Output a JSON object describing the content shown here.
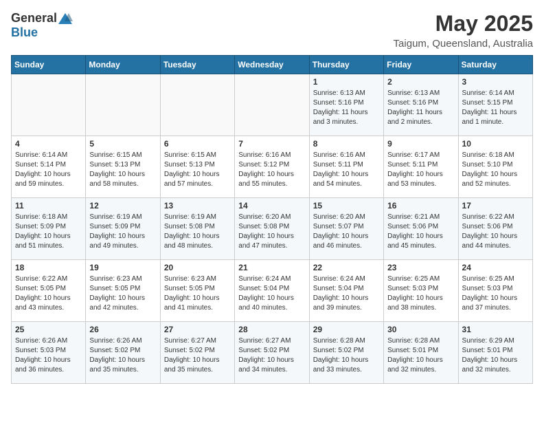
{
  "header": {
    "logo_general": "General",
    "logo_blue": "Blue",
    "month": "May 2025",
    "location": "Taigum, Queensland, Australia"
  },
  "days_of_week": [
    "Sunday",
    "Monday",
    "Tuesday",
    "Wednesday",
    "Thursday",
    "Friday",
    "Saturday"
  ],
  "weeks": [
    [
      {
        "day": "",
        "info": ""
      },
      {
        "day": "",
        "info": ""
      },
      {
        "day": "",
        "info": ""
      },
      {
        "day": "",
        "info": ""
      },
      {
        "day": "1",
        "info": "Sunrise: 6:13 AM\nSunset: 5:16 PM\nDaylight: 11 hours\nand 3 minutes."
      },
      {
        "day": "2",
        "info": "Sunrise: 6:13 AM\nSunset: 5:16 PM\nDaylight: 11 hours\nand 2 minutes."
      },
      {
        "day": "3",
        "info": "Sunrise: 6:14 AM\nSunset: 5:15 PM\nDaylight: 11 hours\nand 1 minute."
      }
    ],
    [
      {
        "day": "4",
        "info": "Sunrise: 6:14 AM\nSunset: 5:14 PM\nDaylight: 10 hours\nand 59 minutes."
      },
      {
        "day": "5",
        "info": "Sunrise: 6:15 AM\nSunset: 5:13 PM\nDaylight: 10 hours\nand 58 minutes."
      },
      {
        "day": "6",
        "info": "Sunrise: 6:15 AM\nSunset: 5:13 PM\nDaylight: 10 hours\nand 57 minutes."
      },
      {
        "day": "7",
        "info": "Sunrise: 6:16 AM\nSunset: 5:12 PM\nDaylight: 10 hours\nand 55 minutes."
      },
      {
        "day": "8",
        "info": "Sunrise: 6:16 AM\nSunset: 5:11 PM\nDaylight: 10 hours\nand 54 minutes."
      },
      {
        "day": "9",
        "info": "Sunrise: 6:17 AM\nSunset: 5:11 PM\nDaylight: 10 hours\nand 53 minutes."
      },
      {
        "day": "10",
        "info": "Sunrise: 6:18 AM\nSunset: 5:10 PM\nDaylight: 10 hours\nand 52 minutes."
      }
    ],
    [
      {
        "day": "11",
        "info": "Sunrise: 6:18 AM\nSunset: 5:09 PM\nDaylight: 10 hours\nand 51 minutes."
      },
      {
        "day": "12",
        "info": "Sunrise: 6:19 AM\nSunset: 5:09 PM\nDaylight: 10 hours\nand 49 minutes."
      },
      {
        "day": "13",
        "info": "Sunrise: 6:19 AM\nSunset: 5:08 PM\nDaylight: 10 hours\nand 48 minutes."
      },
      {
        "day": "14",
        "info": "Sunrise: 6:20 AM\nSunset: 5:08 PM\nDaylight: 10 hours\nand 47 minutes."
      },
      {
        "day": "15",
        "info": "Sunrise: 6:20 AM\nSunset: 5:07 PM\nDaylight: 10 hours\nand 46 minutes."
      },
      {
        "day": "16",
        "info": "Sunrise: 6:21 AM\nSunset: 5:06 PM\nDaylight: 10 hours\nand 45 minutes."
      },
      {
        "day": "17",
        "info": "Sunrise: 6:22 AM\nSunset: 5:06 PM\nDaylight: 10 hours\nand 44 minutes."
      }
    ],
    [
      {
        "day": "18",
        "info": "Sunrise: 6:22 AM\nSunset: 5:05 PM\nDaylight: 10 hours\nand 43 minutes."
      },
      {
        "day": "19",
        "info": "Sunrise: 6:23 AM\nSunset: 5:05 PM\nDaylight: 10 hours\nand 42 minutes."
      },
      {
        "day": "20",
        "info": "Sunrise: 6:23 AM\nSunset: 5:05 PM\nDaylight: 10 hours\nand 41 minutes."
      },
      {
        "day": "21",
        "info": "Sunrise: 6:24 AM\nSunset: 5:04 PM\nDaylight: 10 hours\nand 40 minutes."
      },
      {
        "day": "22",
        "info": "Sunrise: 6:24 AM\nSunset: 5:04 PM\nDaylight: 10 hours\nand 39 minutes."
      },
      {
        "day": "23",
        "info": "Sunrise: 6:25 AM\nSunset: 5:03 PM\nDaylight: 10 hours\nand 38 minutes."
      },
      {
        "day": "24",
        "info": "Sunrise: 6:25 AM\nSunset: 5:03 PM\nDaylight: 10 hours\nand 37 minutes."
      }
    ],
    [
      {
        "day": "25",
        "info": "Sunrise: 6:26 AM\nSunset: 5:03 PM\nDaylight: 10 hours\nand 36 minutes."
      },
      {
        "day": "26",
        "info": "Sunrise: 6:26 AM\nSunset: 5:02 PM\nDaylight: 10 hours\nand 35 minutes."
      },
      {
        "day": "27",
        "info": "Sunrise: 6:27 AM\nSunset: 5:02 PM\nDaylight: 10 hours\nand 35 minutes."
      },
      {
        "day": "28",
        "info": "Sunrise: 6:27 AM\nSunset: 5:02 PM\nDaylight: 10 hours\nand 34 minutes."
      },
      {
        "day": "29",
        "info": "Sunrise: 6:28 AM\nSunset: 5:02 PM\nDaylight: 10 hours\nand 33 minutes."
      },
      {
        "day": "30",
        "info": "Sunrise: 6:28 AM\nSunset: 5:01 PM\nDaylight: 10 hours\nand 32 minutes."
      },
      {
        "day": "31",
        "info": "Sunrise: 6:29 AM\nSunset: 5:01 PM\nDaylight: 10 hours\nand 32 minutes."
      }
    ]
  ]
}
